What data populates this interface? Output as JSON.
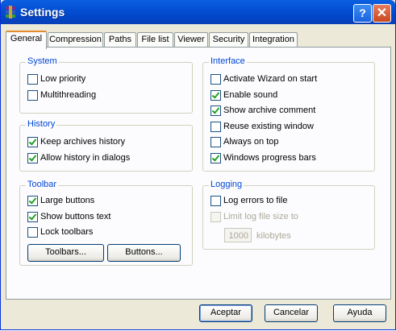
{
  "window": {
    "title": "Settings",
    "help_symbol": "?",
    "close_symbol": "✕"
  },
  "tabs": [
    "General",
    "Compression",
    "Paths",
    "File list",
    "Viewer",
    "Security",
    "Integration"
  ],
  "system": {
    "title": "System",
    "items": [
      {
        "label": "Low priority",
        "checked": false
      },
      {
        "label": "Multithreading",
        "checked": false
      }
    ]
  },
  "history": {
    "title": "History",
    "items": [
      {
        "label": "Keep archives history",
        "checked": true
      },
      {
        "label": "Allow history in dialogs",
        "checked": true
      }
    ]
  },
  "toolbar": {
    "title": "Toolbar",
    "items": [
      {
        "label": "Large buttons",
        "checked": true
      },
      {
        "label": "Show buttons text",
        "checked": true
      },
      {
        "label": "Lock toolbars",
        "checked": false
      }
    ],
    "toolbars_button": "Toolbars...",
    "buttons_button": "Buttons..."
  },
  "interface": {
    "title": "Interface",
    "items": [
      {
        "label": "Activate Wizard on start",
        "checked": false
      },
      {
        "label": "Enable sound",
        "checked": true
      },
      {
        "label": "Show archive comment",
        "checked": true
      },
      {
        "label": "Reuse existing window",
        "checked": false
      },
      {
        "label": "Always on top",
        "checked": false
      },
      {
        "label": "Windows progress bars",
        "checked": true
      }
    ]
  },
  "logging": {
    "title": "Logging",
    "log_errors": {
      "label": "Log errors to file",
      "checked": false
    },
    "limit_size": {
      "label": "Limit log file size to",
      "checked": false,
      "disabled": true
    },
    "size_value": "1000",
    "size_unit": "kilobytes"
  },
  "footer": {
    "ok": "Aceptar",
    "cancel": "Cancelar",
    "help": "Ayuda"
  }
}
